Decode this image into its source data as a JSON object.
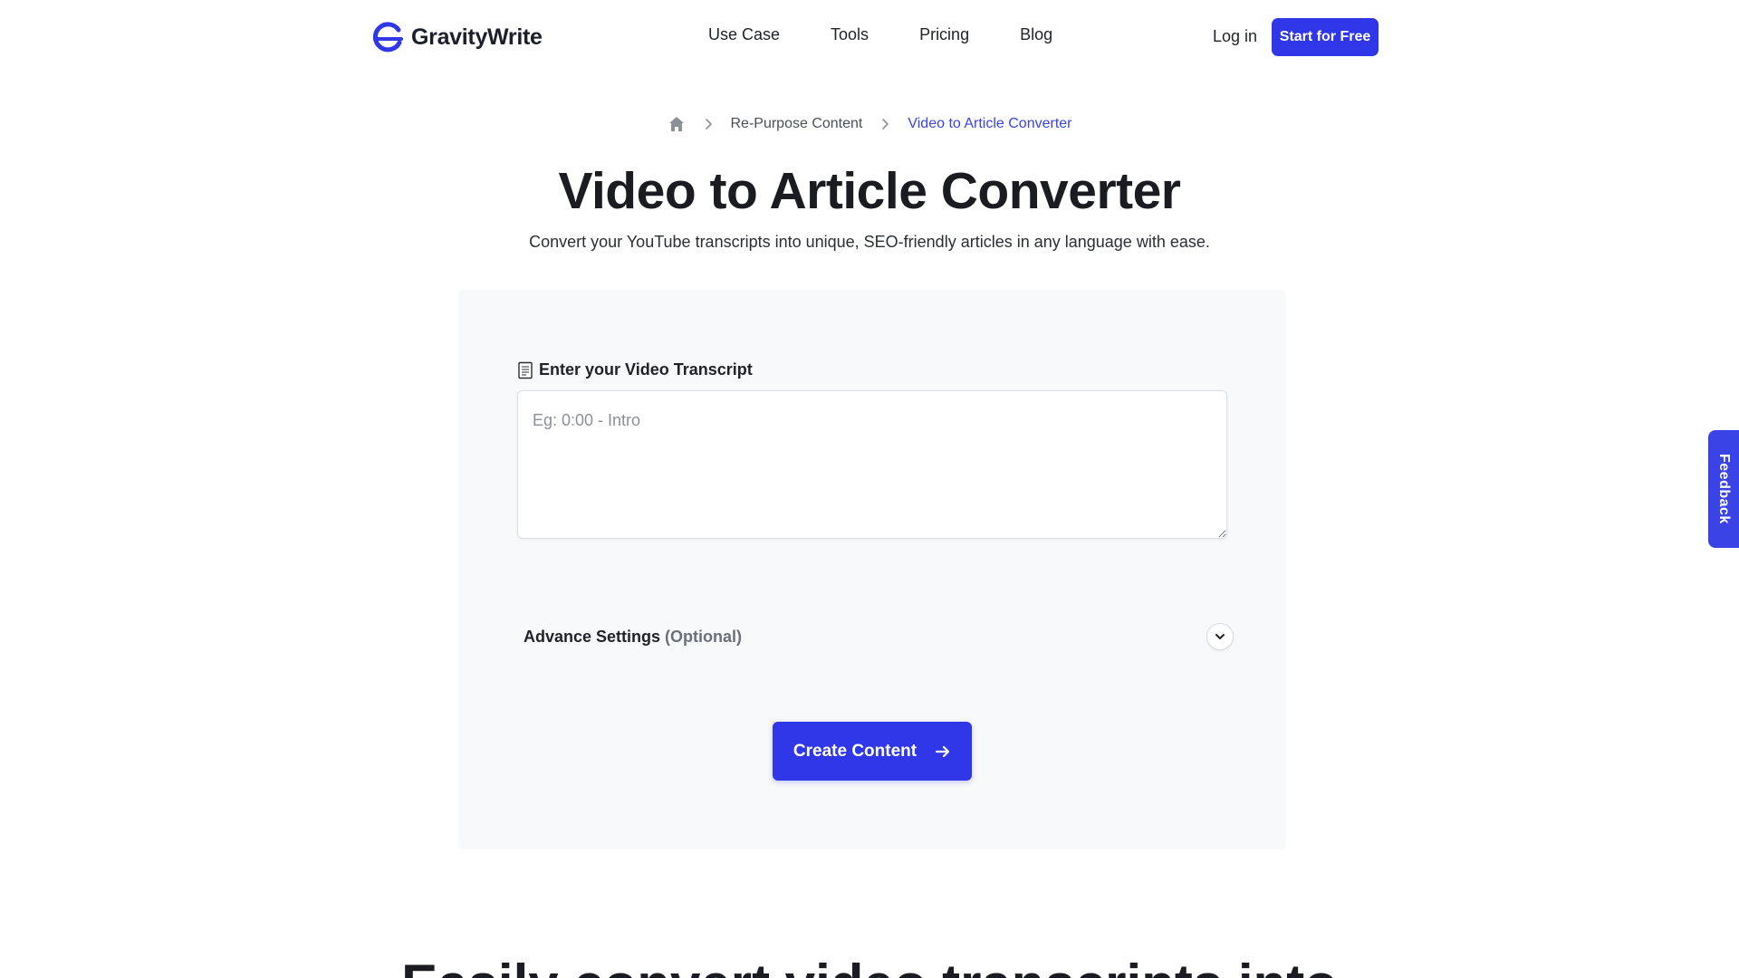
{
  "header": {
    "logo_text": "GravityWrite",
    "nav": [
      {
        "label": "Use Case"
      },
      {
        "label": "Tools"
      },
      {
        "label": "Pricing"
      },
      {
        "label": "Blog"
      }
    ],
    "login_label": "Log in",
    "start_label": "Start for Free"
  },
  "breadcrumb": {
    "home_icon": "home-icon",
    "items": [
      "Re-Purpose Content",
      "Video to Article Converter"
    ]
  },
  "page": {
    "title": "Video to Article Converter",
    "subtitle": "Convert your YouTube transcripts into unique, SEO-friendly articles in any language with ease."
  },
  "form": {
    "transcript_label": "Enter your Video Transcript",
    "transcript_placeholder": "Eg: 0:00 - Intro",
    "transcript_value": "",
    "advance_label": "Advance Settings",
    "advance_optional": "(Optional)",
    "create_label": "Create Content"
  },
  "feedback_label": "Feedback",
  "next_section_heading": "Easily convert video transcripts into",
  "colors": {
    "brand": "#2f37e8",
    "breadcrumb_active": "#3a43e6",
    "panel_bg": "#f8f9fb"
  }
}
